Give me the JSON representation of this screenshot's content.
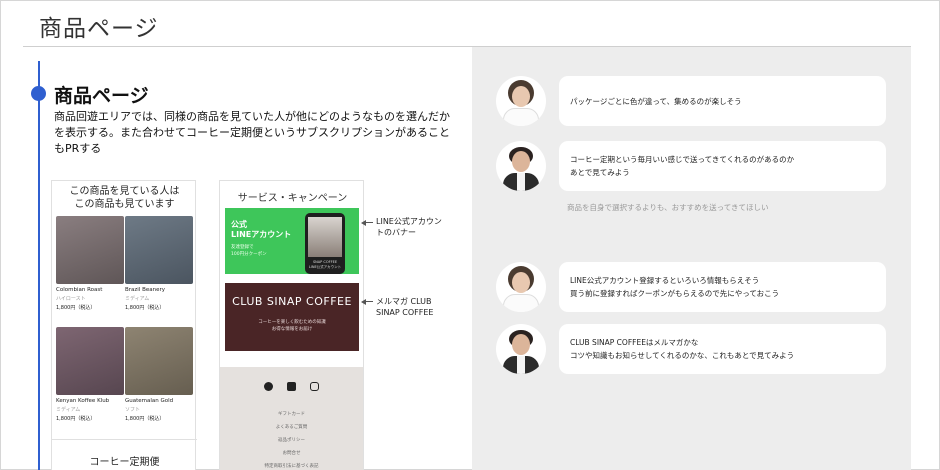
{
  "slide": {
    "title": "商品ページ"
  },
  "section": {
    "heading": "商品ページ",
    "description": "商品回遊エリアでは、同様の商品を見ていた人が他にどのようなものを選んだかを表示する。また合わせてコーヒー定期便というサブスクリプションがあることもPRする"
  },
  "product_mock": {
    "title_line1": "この商品を見ている人は",
    "title_line2": "この商品も見ています",
    "products": [
      {
        "name": "Colombian Roast",
        "sub": "ハイロースト",
        "price": "1,800円（税込）"
      },
      {
        "name": "Brazil Beanery",
        "sub": "ミディアム",
        "price": "1,800円（税込）"
      },
      {
        "name": "Kenyan Koffee Klub",
        "sub": "ミディアム",
        "price": "1,800円（税込）"
      },
      {
        "name": "Guatemalan Gold",
        "sub": "ソフト",
        "price": "1,800円（税込）"
      }
    ],
    "subscription_label": "コーヒー定期便"
  },
  "service_mock": {
    "title": "サービス・キャンペーン",
    "line_banner": {
      "line1": "公式",
      "line2": "LINEアカウント",
      "sub1": "友達登録で",
      "sub2": "100円分クーポン",
      "phone_caption1": "SNAP COFFEE",
      "phone_caption2": "LINE公式アカウント"
    },
    "club_banner": {
      "title": "CLUB SINAP COFFEE",
      "sub1": "コーヒーを楽しく飲むための知識",
      "sub2": "お得な情報をお届け"
    },
    "footer_links": [
      "ギフトカード",
      "よくあるご質問",
      "返品ポリシー",
      "お問合せ",
      "特定商取引法に基づく表記"
    ],
    "social_icons": [
      "facebook-icon",
      "twitter-icon",
      "instagram-icon"
    ]
  },
  "annotations": {
    "line": "LINE公式アカウントのバナー",
    "line_line1": "LINE公式アカウン",
    "line_line2": "トのバナー",
    "club_line1": "メルマガ CLUB",
    "club_line2": "SINAP COFFEE"
  },
  "feedback": {
    "comments": [
      {
        "line1": "パッケージごとに色が違って、集めるのが楽しそう",
        "line2": ""
      },
      {
        "line1": "コーヒー定期という毎月いい感じで送ってきてくれるのがあるのか",
        "line2": "あとで見てみよう"
      },
      {
        "line1": "LINE公式アカウント登録するといろいろ情報もらえそう",
        "line2": "買う前に登録すればクーポンがもらえるので先にやっておこう"
      },
      {
        "line1": "CLUB SINAP COFFEEはメルマガかな",
        "line2": "コツや知識もお知らせしてくれるのかな、これもあとで見てみよう"
      }
    ],
    "summary": "商品を自身で選択するよりも、おすすめを送ってきてほしい"
  },
  "colors": {
    "accent": "#2f5fd0",
    "panel_bg": "#ededed",
    "line_green": "#3ec65a",
    "club_brown": "#4a2526"
  }
}
